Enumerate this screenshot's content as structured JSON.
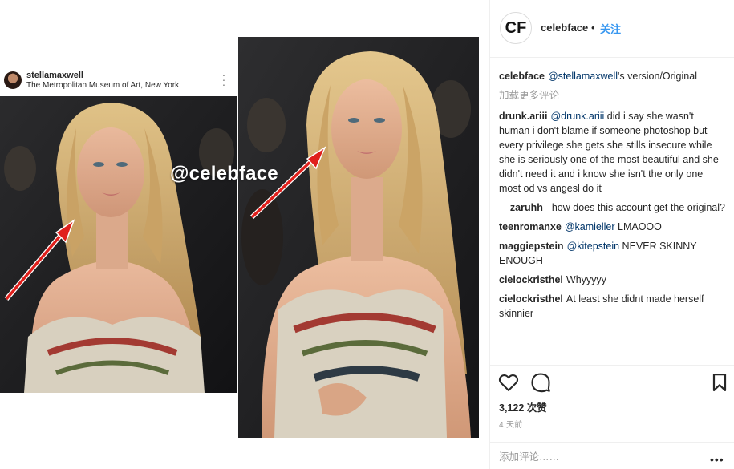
{
  "original_post": {
    "username": "stellamaxwell",
    "location": "The Metropolitan Museum of Art, New York",
    "more_icon": "more-vertical-icon"
  },
  "watermark": "@celebface",
  "header": {
    "avatar_text": "CF",
    "username": "celebface",
    "separator": "•",
    "follow_label": "关注"
  },
  "caption": {
    "user": "celebface",
    "mention": "@stellamaxwell",
    "text": "'s version/Original"
  },
  "load_more_label": "加载更多评论",
  "comments": [
    {
      "user": "drunk.ariii",
      "mention": "@drunk.ariii",
      "text": " did i say she wasn't human i don't blame if someone photoshop but every privilege she gets she stills insecure while she is seriously one of the most beautiful and she didn't need it and i know she isn't the only one most od vs angesl do it"
    },
    {
      "user": "__zaruhh_",
      "mention": "",
      "text": "how does this account get the original?"
    },
    {
      "user": "teenromanxe",
      "mention": "@kamieller",
      "text": " LMAOOO"
    },
    {
      "user": "maggiepstein",
      "mention": "@kitepstein",
      "text": " NEVER SKINNY ENOUGH"
    },
    {
      "user": "cielockristhel",
      "mention": "",
      "text": "Whyyyyy"
    },
    {
      "user": "cielockristhel",
      "mention": "",
      "text": "At least she didnt made herself skinnier"
    }
  ],
  "actions": {
    "like_icon": "heart-icon",
    "comment_icon": "comment-bubble-icon",
    "save_icon": "bookmark-icon"
  },
  "likes_label": "3,122 次赞",
  "time_label": "4 天前",
  "add_comment_placeholder": "添加评论……",
  "more_label": "•••",
  "colors": {
    "link": "#3897f0",
    "mention": "#003569",
    "arrow": "#e0201c",
    "muted": "#999999",
    "border": "#efefef"
  }
}
